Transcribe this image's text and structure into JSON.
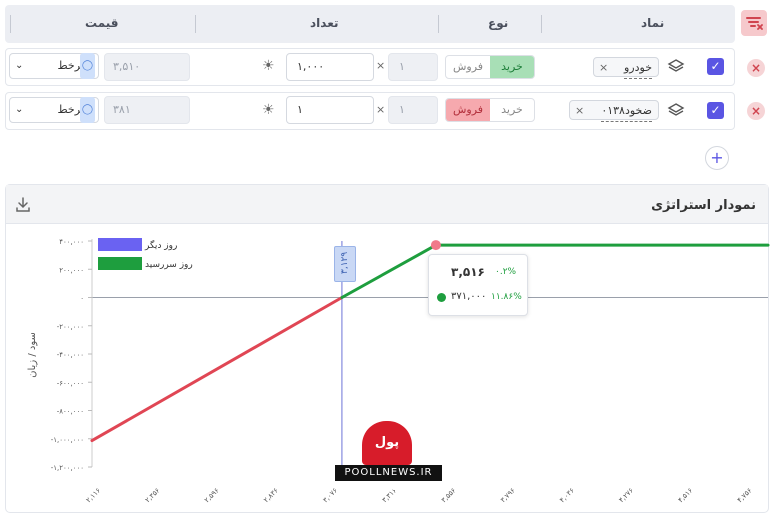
{
  "columns": {
    "symbol": "نماد",
    "type": "نوع",
    "quantity": "تعداد",
    "price": "قیمت"
  },
  "rows": [
    {
      "symbol": "خودرو",
      "buy_label": "خرید",
      "sell_label": "فروش",
      "active_side": "buy",
      "multiplier": "۱",
      "quantity": "۱,۰۰۰",
      "price": "۳,۵۱۰",
      "price_type": "سرخط"
    },
    {
      "symbol": "ضخود۰۱۳۸",
      "buy_label": "خرید",
      "sell_label": "فروش",
      "active_side": "sell",
      "multiplier": "۱",
      "quantity": "۱",
      "price": "۳۸۱",
      "price_type": "سرخط"
    }
  ],
  "chart": {
    "title": "نمودار استراتژی",
    "ylabel": "سود / زیان",
    "legend": [
      "روز دیگر",
      "روز سررسید"
    ],
    "breakeven_label": "۳,۱۲۹",
    "tooltip": {
      "price": "۳,۵۱۶",
      "price_pct": "۰.۲%",
      "profit": "۳۷۱,۰۰۰",
      "profit_pct": "۱۱.۸۶%"
    },
    "watermark": "POOLLNEWS.IR",
    "watermark_logo": "پول نیوز"
  },
  "chart_data": {
    "type": "line",
    "title": "نمودار استراتژی",
    "xlabel": "",
    "ylabel": "سود / زیان",
    "x_ticks": [
      "۲,۱۱۶",
      "۲,۳۵۶",
      "۲,۵۹۶",
      "۲,۸۳۶",
      "۳,۰۷۶",
      "۳,۳۱۶",
      "۳,۵۵۶",
      "۳,۷۹۶",
      "۴,۰۳۶",
      "۴,۲۷۶",
      "۴,۵۱۶",
      "۴,۷۵۶"
    ],
    "y_ticks": [
      "۴۰۰,۰۰۰",
      "۲۰۰,۰۰۰",
      "۰",
      "-۲۰۰,۰۰۰",
      "-۴۰۰,۰۰۰",
      "-۶۰۰,۰۰۰",
      "-۸۰۰,۰۰۰",
      "-۱,۰۰۰,۰۰۰",
      "-۱,۲۰۰,۰۰۰"
    ],
    "xlim": [
      2116,
      4856
    ],
    "ylim": [
      -1200000,
      400000
    ],
    "breakeven": 3129,
    "series": [
      {
        "name": "روز سررسید",
        "color": "#1e9e3e",
        "points": [
          [
            2116,
            -1013000
          ],
          [
            3129,
            0
          ],
          [
            3510,
            371000
          ],
          [
            4856,
            371000
          ]
        ]
      }
    ],
    "highlight": {
      "x": 3510,
      "y": 371000
    }
  },
  "colors": {
    "accent": "#5a55e3",
    "loss": "#e04654",
    "profit": "#1e9e3e",
    "other_day": "#6a62f2",
    "buy_bg": "#a8dfb6",
    "sell_bg": "#f6a9ae"
  }
}
